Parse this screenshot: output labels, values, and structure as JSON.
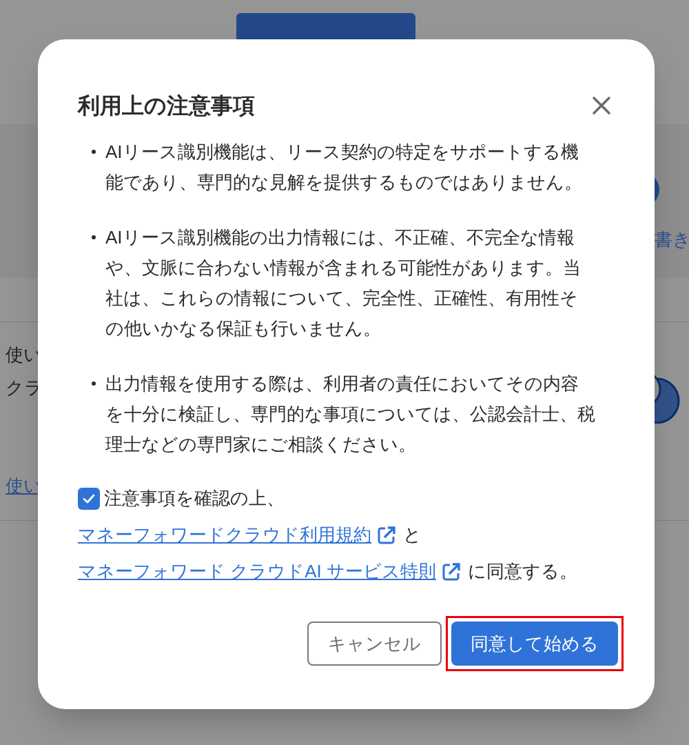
{
  "background": {
    "left_texts": [
      "使い",
      "クラ"
    ],
    "left_link": "使い",
    "right_link": "書き"
  },
  "dialog": {
    "title": "利用上の注意事項",
    "bullets": [
      "AIリース識別機能は、リース契約の特定をサポートする機能であり、専門的な見解を提供するものではありません。",
      "AIリース識別機能の出力情報には、不正確、不完全な情報や、文脈に合わない情報が含まれる可能性があります。当社は、これらの情報について、完全性、正確性、有用性その他いかなる保証も行いません。",
      "出力情報を使用する際は、利用者の責任においてその内容を十分に検証し、専門的な事項については、公認会計士、税理士などの専門家にご相談ください。"
    ],
    "consent": {
      "checked": true,
      "lead": "注意事項を確認の上、",
      "links": [
        {
          "label": "マネーフォワードクラウド利用規約",
          "after": "と"
        },
        {
          "label": "マネーフォワード クラウドAI サービス特則",
          "after": "に同意する。"
        }
      ]
    },
    "buttons": [
      {
        "label": "キャンセル",
        "kind": "secondary",
        "highlighted": false
      },
      {
        "label": "同意して始める",
        "kind": "primary",
        "highlighted": true
      }
    ]
  }
}
